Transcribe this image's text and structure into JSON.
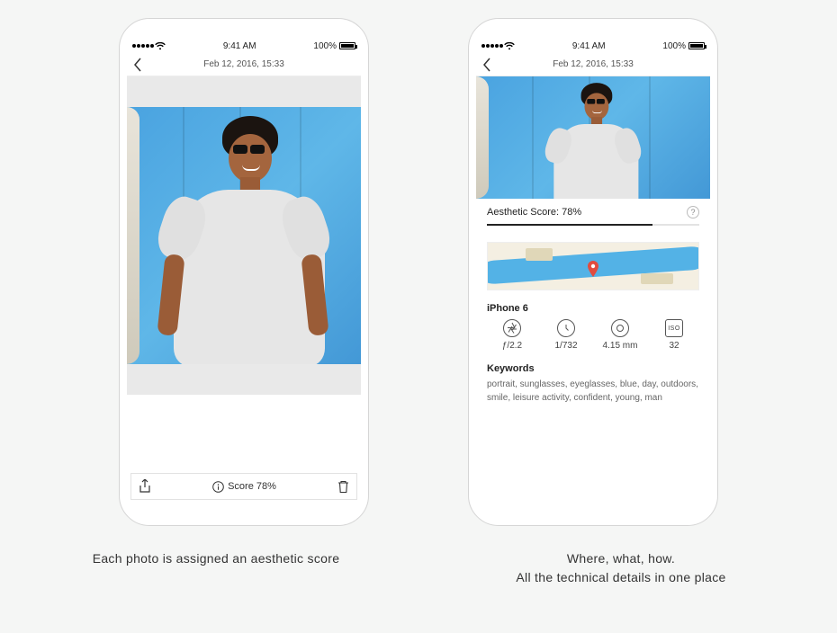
{
  "status": {
    "time": "9:41 AM",
    "battery_text": "100%"
  },
  "nav": {
    "title": "Feb 12, 2016, 15:33"
  },
  "left": {
    "toolbar": {
      "score_label": "Score 78%"
    }
  },
  "right": {
    "score": {
      "label": "Aesthetic Score: 78%",
      "percent": 78
    },
    "device": "iPhone 6",
    "exif": {
      "aperture": "ƒ/2.2",
      "shutter": "1/732",
      "focal": "4.15 mm",
      "iso_label": "ISO",
      "iso": "32"
    },
    "keywords": {
      "title": "Keywords",
      "body": "portrait, sunglasses, eyeglasses, blue, day, outdoors, smile, leisure activity, confident, young, man"
    }
  },
  "captions": {
    "left": "Each photo is assigned an aesthetic score",
    "right_line1": "Where, what, how.",
    "right_line2": "All the technical details in one place"
  }
}
